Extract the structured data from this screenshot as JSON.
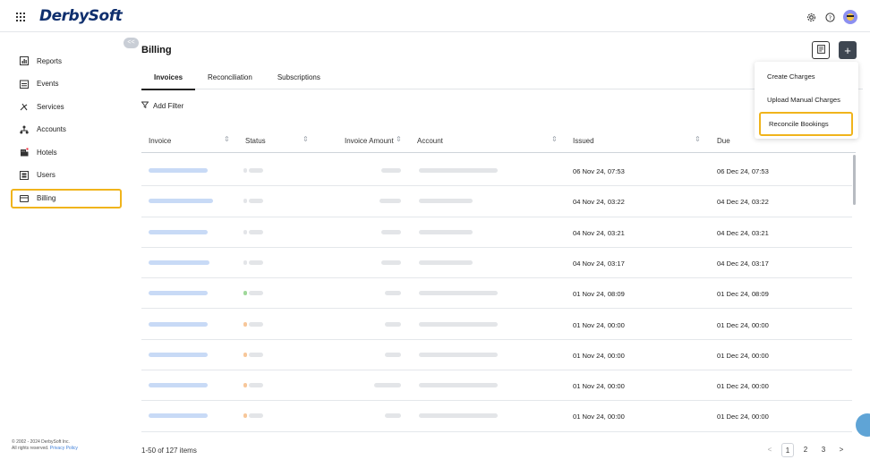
{
  "topbar": {
    "logo": "DerbySoft",
    "icons": [
      "grid-menu-icon",
      "settings-icon",
      "help-icon",
      "user-avatar"
    ]
  },
  "sidebar": {
    "collapse_label": "<<",
    "items": [
      {
        "label": "Reports",
        "icon": "reports-icon"
      },
      {
        "label": "Events",
        "icon": "events-icon"
      },
      {
        "label": "Services",
        "icon": "services-icon"
      },
      {
        "label": "Accounts",
        "icon": "accounts-icon"
      },
      {
        "label": "Hotels",
        "icon": "hotels-icon"
      },
      {
        "label": "Users",
        "icon": "users-icon"
      },
      {
        "label": "Billing",
        "icon": "billing-icon",
        "active": true
      }
    ],
    "footer": {
      "copyright": "© 2002 - 2024 DerbySoft Inc.",
      "rights": "All rights reserved.",
      "privacy": "Privacy Policy"
    }
  },
  "main": {
    "title": "Billing",
    "plus_label": "+",
    "tabs": [
      {
        "label": "Invoices",
        "active": true
      },
      {
        "label": "Reconciliation"
      },
      {
        "label": "Subscriptions"
      }
    ],
    "add_filter": "Add Filter",
    "columns": [
      "Invoice",
      "Status",
      "Invoice Amount",
      "Account",
      "Issued",
      "Due"
    ],
    "rows": [
      {
        "issued": "06 Nov 24, 07:53",
        "due": "06 Dec 24, 07:53",
        "status_color": "#e3e5e8"
      },
      {
        "issued": "04 Nov 24, 03:22",
        "due": "04 Dec 24, 03:22",
        "status_color": "#e3e5e8"
      },
      {
        "issued": "04 Nov 24, 03:21",
        "due": "04 Dec 24, 03:21",
        "status_color": "#e3e5e8"
      },
      {
        "issued": "04 Nov 24, 03:17",
        "due": "04 Dec 24, 03:17",
        "status_color": "#e3e5e8"
      },
      {
        "issued": "01 Nov 24, 08:09",
        "due": "01 Dec 24, 08:09",
        "status_color": "#9fd89a"
      },
      {
        "issued": "01 Nov 24, 00:00",
        "due": "01 Dec 24, 00:00",
        "status_color": "#f7c79a"
      },
      {
        "issued": "01 Nov 24, 00:00",
        "due": "01 Dec 24, 00:00",
        "status_color": "#f7c79a"
      },
      {
        "issued": "01 Nov 24, 00:00",
        "due": "01 Dec 24, 00:00",
        "status_color": "#f7c79a"
      },
      {
        "issued": "01 Nov 24, 00:00",
        "due": "01 Dec 24, 00:00",
        "status_color": "#f7c79a"
      }
    ],
    "pagination": {
      "summary": "1-50 of 127 items",
      "pages": [
        "1",
        "2",
        "3"
      ],
      "current": "1",
      "prev": "<",
      "next": ">"
    }
  },
  "dropdown": {
    "items": [
      "Create Charges",
      "Upload Manual Charges",
      "Reconcile Bookings"
    ],
    "highlighted": "Reconcile Bookings"
  },
  "colors": {
    "accent_highlight": "#f0b41c",
    "logo": "#0f2f6e",
    "plus_button": "#3e4651",
    "link": "#3f7fd8"
  }
}
